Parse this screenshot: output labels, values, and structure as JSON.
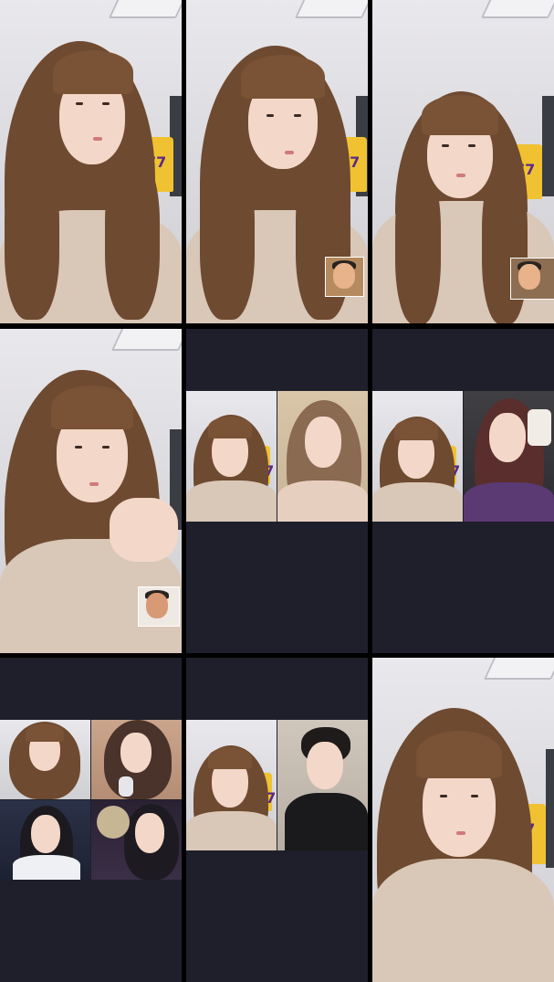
{
  "layout": {
    "columns": 3,
    "rows": 3
  },
  "colors": {
    "background": "#000000",
    "empty_panel": "#1e1f2b",
    "hair": "#6e4a30",
    "skin": "#f3d7c8",
    "jersey": "#f0c232"
  },
  "panels": [
    {
      "kind": "single-stream",
      "pip": false
    },
    {
      "kind": "single-stream",
      "pip": true
    },
    {
      "kind": "single-stream",
      "pip": true
    },
    {
      "kind": "single-stream",
      "pip": true
    },
    {
      "kind": "two-way-split"
    },
    {
      "kind": "two-way-split"
    },
    {
      "kind": "four-way-split"
    },
    {
      "kind": "two-way-split"
    },
    {
      "kind": "single-stream",
      "pip": false
    }
  ]
}
